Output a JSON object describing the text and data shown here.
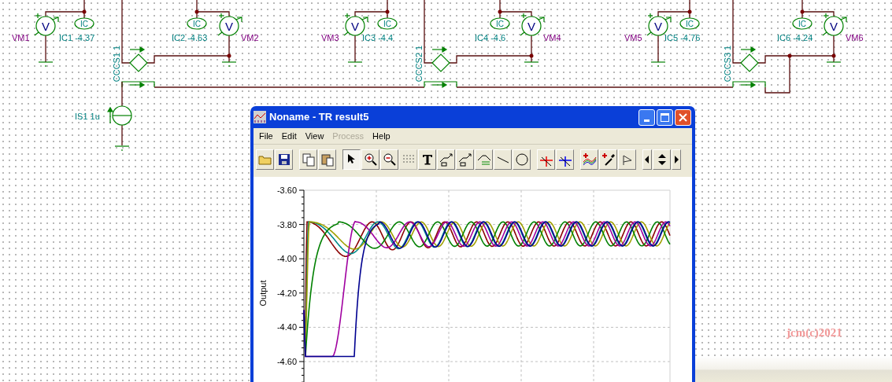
{
  "schematic": {
    "stages": [
      {
        "input_meter": {
          "symbol": "V",
          "label": "VM1"
        },
        "input_ammeter": {
          "symbol": "IC",
          "label": "IC1 -4.37"
        },
        "source_label": "CCCS1 1",
        "output_ammeter": {
          "symbol": "IC",
          "label": "IC2 -4.63"
        },
        "output_meter": {
          "symbol": "V",
          "label": "VM2"
        }
      },
      {
        "input_meter": {
          "symbol": "V",
          "label": "VM3"
        },
        "input_ammeter": {
          "symbol": "IC",
          "label": "IC3 -4.4"
        },
        "source_label": "CCCS2 1",
        "output_ammeter": {
          "symbol": "IC",
          "label": "IC4 -4.6"
        },
        "output_meter": {
          "symbol": "V",
          "label": "VM4"
        }
      },
      {
        "input_meter": {
          "symbol": "V",
          "label": "VM5"
        },
        "input_ammeter": {
          "symbol": "IC",
          "label": "IC5 -4.76"
        },
        "source_label": "CCCS3 1",
        "output_ammeter": {
          "symbol": "IC",
          "label": "IC6 -4.24"
        },
        "output_meter": {
          "symbol": "V",
          "label": "VM6"
        }
      }
    ],
    "current_source_label": "IS1 1u",
    "copyright": "jcm(c)2021"
  },
  "window": {
    "title": "Noname - TR result5",
    "menu": [
      {
        "label": "File",
        "disabled": false
      },
      {
        "label": "Edit",
        "disabled": false
      },
      {
        "label": "View",
        "disabled": false
      },
      {
        "label": "Process",
        "disabled": true
      },
      {
        "label": "Help",
        "disabled": false
      }
    ],
    "toolbar": [
      [
        {
          "kind": "open",
          "selected": false,
          "disabled": false
        },
        {
          "kind": "save",
          "selected": false,
          "disabled": false
        }
      ],
      [
        {
          "kind": "copy",
          "selected": false,
          "disabled": false
        },
        {
          "kind": "paste",
          "selected": false,
          "disabled": false
        }
      ],
      [
        {
          "kind": "pointer",
          "selected": true,
          "disabled": false
        },
        {
          "kind": "zoom_in",
          "selected": false,
          "disabled": false
        },
        {
          "kind": "zoom_out",
          "selected": false,
          "disabled": false
        },
        {
          "kind": "grid",
          "selected": false,
          "disabled": true
        },
        {
          "kind": "text",
          "selected": false,
          "disabled": false
        },
        {
          "kind": "label",
          "selected": false,
          "disabled": false
        },
        {
          "kind": "label",
          "selected": false,
          "disabled": false
        },
        {
          "kind": "table",
          "selected": false,
          "disabled": false
        },
        {
          "kind": "line",
          "selected": false,
          "disabled": false
        },
        {
          "kind": "circle",
          "selected": false,
          "disabled": false
        }
      ],
      [
        {
          "kind": "cursor_a",
          "selected": false,
          "disabled": false
        },
        {
          "kind": "cursor_b",
          "selected": false,
          "disabled": false
        }
      ],
      [
        {
          "kind": "add_curves",
          "selected": false,
          "disabled": false
        },
        {
          "kind": "probe",
          "selected": false,
          "disabled": false
        },
        {
          "kind": "flag",
          "selected": false,
          "disabled": false
        }
      ],
      [
        {
          "kind": "left",
          "selected": false,
          "disabled": false
        },
        {
          "kind": "updown",
          "selected": false,
          "disabled": false
        },
        {
          "kind": "right",
          "selected": false,
          "disabled": false
        }
      ]
    ],
    "plot": {
      "ylabel": "Output",
      "yticks": [
        "-3.60",
        "-3.80",
        "-4.00",
        "-4.20",
        "-4.40",
        "-4.60"
      ]
    }
  }
}
